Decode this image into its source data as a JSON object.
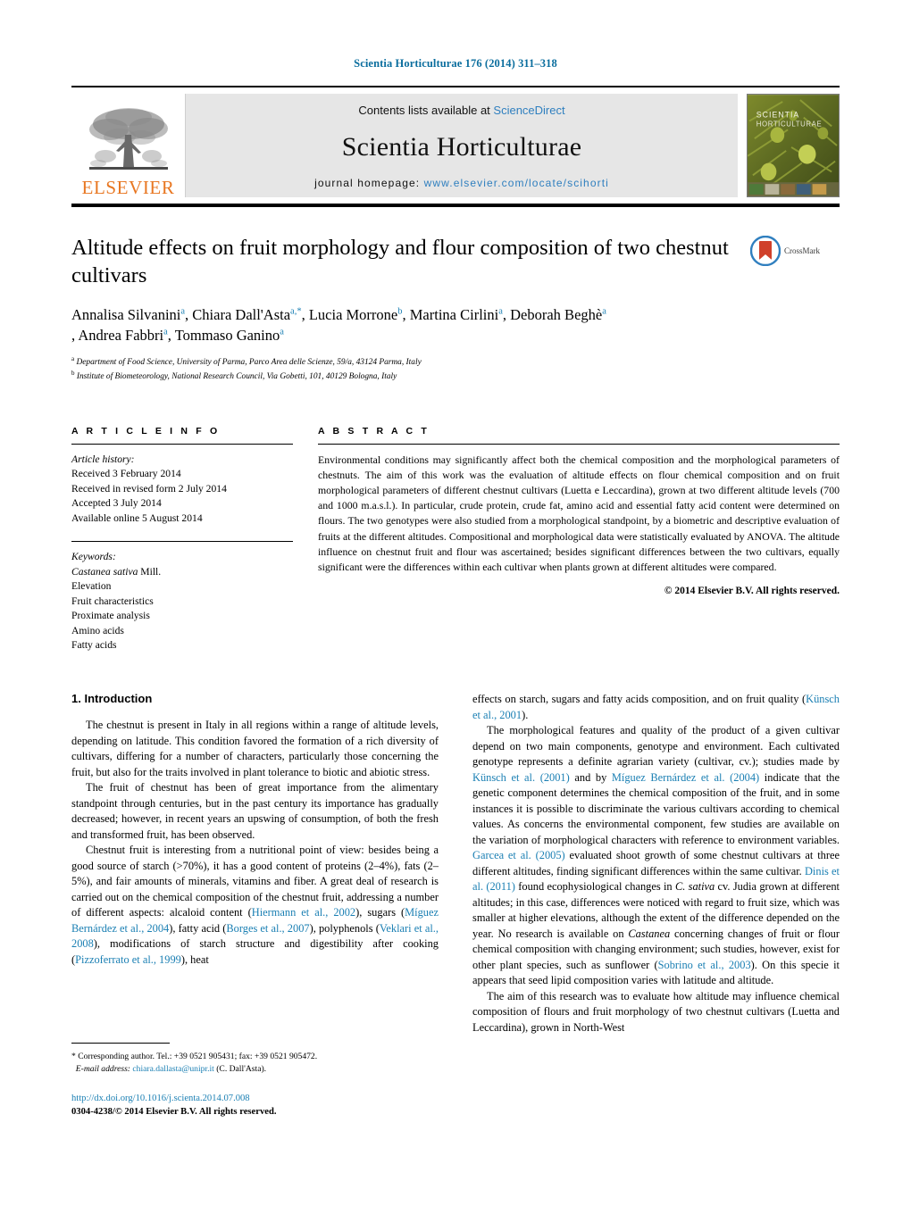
{
  "running_head": "Scientia Horticulturae 176 (2014) 311–318",
  "masthead": {
    "publisher_name": "ELSEVIER",
    "contents_prefix": "Contents lists available at ",
    "contents_link": "ScienceDirect",
    "journal_title": "Scientia Horticulturae",
    "homepage_prefix": "journal homepage: ",
    "homepage_url": "www.elsevier.com/locate/scihorti",
    "cover_title_line1": "SCIENTIA",
    "cover_title_line2": "HORTICULTURAE"
  },
  "article": {
    "title": "Altitude effects on fruit morphology and flour composition of two chestnut cultivars",
    "crossmark_label": "CrossMark",
    "authors_line1": "Annalisa Silvanini<sup>a</sup>, Chiara Dall'Asta<sup>a,*</sup>, Lucia Morrone<sup>b</sup>, Martina Cirlini<sup>a</sup>, Deborah Beghè<sup>a</sup>",
    "authors_line2": ", Andrea Fabbri<sup>a</sup>, Tommaso Ganino<sup>a</sup>",
    "affiliation_a": "Department of Food Science, University of Parma, Parco Area delle Scienze, 59/a, 43124 Parma, Italy",
    "affiliation_b": "Institute of Biometeorology, National Research Council, Via Gobetti, 101, 40129 Bologna, Italy"
  },
  "article_info": {
    "heading": "A R T I C L E   I N F O",
    "history_label": "Article history:",
    "history": [
      "Received 3 February 2014",
      "Received in revised form 2 July 2014",
      "Accepted 3 July 2014",
      "Available online 5 August 2014"
    ],
    "keywords_label": "Keywords:",
    "keywords": [
      "Castanea sativa Mill.",
      "Elevation",
      "Fruit characteristics",
      "Proximate analysis",
      "Amino acids",
      "Fatty acids"
    ]
  },
  "abstract": {
    "heading": "A B S T R A C T",
    "text": "Environmental conditions may significantly affect both the chemical composition and the morphological parameters of chestnuts. The aim of this work was the evaluation of altitude effects on flour chemical composition and on fruit morphological parameters of different chestnut cultivars (Luetta e Leccardina), grown at two different altitude levels (700 and 1000 m.a.s.l.). In particular, crude protein, crude fat, amino acid and essential fatty acid content were determined on flours. The two genotypes were also studied from a morphological standpoint, by a biometric and descriptive evaluation of fruits at the different altitudes. Compositional and morphological data were statistically evaluated by ANOVA. The altitude influence on chestnut fruit and flour was ascertained; besides significant differences between the two cultivars, equally significant were the differences within each cultivar when plants grown at different altitudes were compared.",
    "copyright": "© 2014 Elsevier B.V. All rights reserved."
  },
  "intro": {
    "heading": "1.  Introduction",
    "left_p1": "The chestnut is present in Italy in all regions within a range of altitude levels, depending on latitude. This condition favored the formation of a rich diversity of cultivars, differing for a number of characters, particularly those concerning the fruit, but also for the traits involved in plant tolerance to biotic and abiotic stress.",
    "left_p2": "The fruit of chestnut has been of great importance from the alimentary standpoint through centuries, but in the past century its importance has gradually decreased; however, in recent years an upswing of consumption, of both the fresh and transformed fruit, has been observed.",
    "left_p3_a": "Chestnut fruit is interesting from a nutritional point of view: besides being a good source of starch (>70%), it has a good content of proteins (2–4%), fats (2–5%), and fair amounts of minerals, vitamins and fiber. A great deal of research is carried out on the chemical composition of the chestnut fruit, addressing a number of different aspects: alcaloid content (",
    "left_p3_c1": "Hiermann et al., 2002",
    "left_p3_b": "), sugars (",
    "left_p3_c2": "Míguez Bernárdez et al., 2004",
    "left_p3_d": "), fatty acid (",
    "left_p3_c3": "Borges et al., 2007",
    "left_p3_e": "), polyphenols (",
    "left_p3_c4": "Veklari et al., 2008",
    "left_p3_f": "), modifications of starch structure and digestibility after cooking (",
    "left_p3_c5": "Pizzoferrato et al., 1999",
    "left_p3_g": "), heat",
    "right_p1_a": "effects on starch, sugars and fatty acids composition, and on fruit quality (",
    "right_p1_c1": "Künsch et al., 2001",
    "right_p1_b": ").",
    "right_p2_a": "The morphological features and quality of the product of a given cultivar depend on two main components, genotype and environment. Each cultivated genotype represents a definite agrarian variety (cultivar, cv.); studies made by ",
    "right_p2_c1": "Künsch et al. (2001)",
    "right_p2_b": " and by ",
    "right_p2_c2": "Míguez Bernárdez et al. (2004)",
    "right_p2_c": " indicate that the genetic component determines the chemical composition of the fruit, and in some instances it is possible to discriminate the various cultivars according to chemical values. As concerns the environmental component, few studies are available on the variation of morphological characters with reference to environment variables. ",
    "right_p2_c3": "Garcea et al. (2005)",
    "right_p2_d": " evaluated shoot growth of some chestnut cultivars at three different altitudes, finding significant differences within the same cultivar. ",
    "right_p2_c4": "Dinis et al. (2011)",
    "right_p2_e": " found ecophysiological changes in C. sativa cv. Judia grown at different altitudes; in this case, differences were noticed with regard to fruit size, which was smaller at higher elevations, although the extent of the difference depended on the year. No research is available on Castanea concerning changes of fruit or flour chemical composition with changing environment; such studies, however, exist for other plant species, such as sunflower (",
    "right_p2_c5": "Sobrino et al., 2003",
    "right_p2_f": "). On this specie it appears that seed lipid composition varies with latitude and altitude.",
    "right_p3": "The aim of this research was to evaluate how altitude may influence chemical composition of flours and fruit morphology of two chestnut cultivars (Luetta and Leccardina), grown in North-West"
  },
  "footnote": {
    "marker": "*",
    "corresponding": "Corresponding author. Tel.: +39 0521 905431; fax: +39 0521 905472.",
    "email_label": "E-mail address:",
    "email": "chiara.dallasta@unipr.it",
    "email_owner": "(C. Dall'Asta)."
  },
  "doi": {
    "url": "http://dx.doi.org/10.1016/j.scienta.2014.07.008",
    "issn_line": "0304-4238/© 2014 Elsevier B.V. All rights reserved."
  },
  "colors": {
    "link_blue": "#1a7fb3",
    "elsevier_orange": "#e87722",
    "masthead_gray": "#e6e6e6"
  }
}
